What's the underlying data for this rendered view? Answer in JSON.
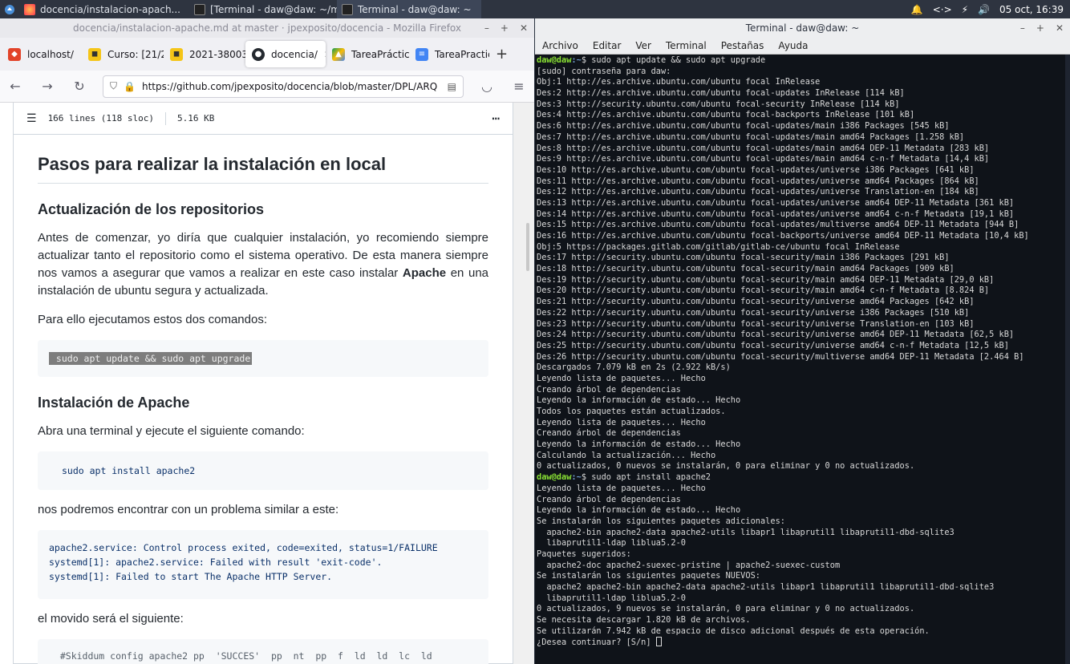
{
  "taskbar": {
    "tasks": [
      {
        "label": "docencia/instalacion-apach..."
      },
      {
        "label": "[Terminal - daw@daw: ~/med..."
      },
      {
        "label": "Terminal - daw@daw: ~"
      }
    ],
    "clock": "05 oct, 16:39"
  },
  "firefox": {
    "title": "docencia/instalacion-apache.md at master · jpexposito/docencia - Mozilla Firefox",
    "tabs": [
      {
        "label": "localhost/"
      },
      {
        "label": "Curso: [21/2"
      },
      {
        "label": "2021-38003"
      },
      {
        "label": "docencia/"
      },
      {
        "label": "TareaPráctic"
      },
      {
        "label": "TareaPractic"
      }
    ],
    "url": "https://github.com/jpexposito/docencia/blob/master/DPL/ARQ",
    "file_info": {
      "lines": "166 lines (118 sloc)",
      "size": "5.16 KB"
    },
    "doc": {
      "h1": "Pasos para realizar la instalación en local",
      "h2_repos": "Actualización de los repositorios",
      "p1_before": "Antes de comenzar, yo diría que cualquier instalación, yo recomiendo siempre actualizar tanto el repositorio como el sistema operativo. De esta manera siempre nos vamos a asegurar que vamos a realizar en este caso instalar ",
      "p1_bold": "Apache",
      "p1_after": " en una instalación de ubuntu segura y actualizada.",
      "p2": "Para ello ejecutamos estos dos comandos:",
      "code1": " sudo apt update && sudo apt upgrade",
      "h2_apache": "Instalación de Apache",
      "p3": "Abra una terminal y ejecute el siguiente comando:",
      "code2": "sudo apt install apache2",
      "p4": "nos podremos encontrar con un problema similar a este:",
      "code3": "apache2.service: Control process exited, code=exited, status=1/FAILURE\nsystemd[1]: apache2.service: Failed with result 'exit-code'.\nsystemd[1]: Failed to start The Apache HTTP Server.",
      "p5": "el movido será el siguiente:",
      "code4": "  #Skiddum config apache2 pp  'SUCCES'  pp  nt  pp  f  ld  ld  lc  ld"
    }
  },
  "terminal": {
    "title": "Terminal - daw@daw: ~",
    "menu": [
      "Archivo",
      "Editar",
      "Ver",
      "Terminal",
      "Pestañas",
      "Ayuda"
    ],
    "prompt_user": "daw@daw",
    "prompt_path": ":~",
    "cmd1": "$ sudo apt update && sudo apt upgrade",
    "output1": [
      "[sudo] contraseña para daw:",
      "Obj:1 http://es.archive.ubuntu.com/ubuntu focal InRelease",
      "Des:2 http://es.archive.ubuntu.com/ubuntu focal-updates InRelease [114 kB]",
      "Des:3 http://security.ubuntu.com/ubuntu focal-security InRelease [114 kB]",
      "Des:4 http://es.archive.ubuntu.com/ubuntu focal-backports InRelease [101 kB]",
      "Des:6 http://es.archive.ubuntu.com/ubuntu focal-updates/main i386 Packages [545 kB]",
      "Des:7 http://es.archive.ubuntu.com/ubuntu focal-updates/main amd64 Packages [1.258 kB]",
      "Des:8 http://es.archive.ubuntu.com/ubuntu focal-updates/main amd64 DEP-11 Metadata [283 kB]",
      "Des:9 http://es.archive.ubuntu.com/ubuntu focal-updates/main amd64 c-n-f Metadata [14,4 kB]",
      "Des:10 http://es.archive.ubuntu.com/ubuntu focal-updates/universe i386 Packages [641 kB]",
      "Des:11 http://es.archive.ubuntu.com/ubuntu focal-updates/universe amd64 Packages [864 kB]",
      "Des:12 http://es.archive.ubuntu.com/ubuntu focal-updates/universe Translation-en [184 kB]",
      "Des:13 http://es.archive.ubuntu.com/ubuntu focal-updates/universe amd64 DEP-11 Metadata [361 kB]",
      "Des:14 http://es.archive.ubuntu.com/ubuntu focal-updates/universe amd64 c-n-f Metadata [19,1 kB]",
      "Des:15 http://es.archive.ubuntu.com/ubuntu focal-updates/multiverse amd64 DEP-11 Metadata [944 B]",
      "Des:16 http://es.archive.ubuntu.com/ubuntu focal-backports/universe amd64 DEP-11 Metadata [10,4 kB]",
      "Obj:5 https://packages.gitlab.com/gitlab/gitlab-ce/ubuntu focal InRelease",
      "Des:17 http://security.ubuntu.com/ubuntu focal-security/main i386 Packages [291 kB]",
      "Des:18 http://security.ubuntu.com/ubuntu focal-security/main amd64 Packages [909 kB]",
      "Des:19 http://security.ubuntu.com/ubuntu focal-security/main amd64 DEP-11 Metadata [29,0 kB]",
      "Des:20 http://security.ubuntu.com/ubuntu focal-security/main amd64 c-n-f Metadata [8.824 B]",
      "Des:21 http://security.ubuntu.com/ubuntu focal-security/universe amd64 Packages [642 kB]",
      "Des:22 http://security.ubuntu.com/ubuntu focal-security/universe i386 Packages [510 kB]",
      "Des:23 http://security.ubuntu.com/ubuntu focal-security/universe Translation-en [103 kB]",
      "Des:24 http://security.ubuntu.com/ubuntu focal-security/universe amd64 DEP-11 Metadata [62,5 kB]",
      "Des:25 http://security.ubuntu.com/ubuntu focal-security/universe amd64 c-n-f Metadata [12,5 kB]",
      "Des:26 http://security.ubuntu.com/ubuntu focal-security/multiverse amd64 DEP-11 Metadata [2.464 B]",
      "Descargados 7.079 kB en 2s (2.922 kB/s)",
      "Leyendo lista de paquetes... Hecho",
      "Creando árbol de dependencias",
      "Leyendo la información de estado... Hecho",
      "Todos los paquetes están actualizados.",
      "Leyendo lista de paquetes... Hecho",
      "Creando árbol de dependencias",
      "Leyendo la información de estado... Hecho",
      "Calculando la actualización... Hecho",
      "0 actualizados, 0 nuevos se instalarán, 0 para eliminar y 0 no actualizados."
    ],
    "cmd2": "$ sudo apt install apache2",
    "output2": [
      "Leyendo lista de paquetes... Hecho",
      "Creando árbol de dependencias",
      "Leyendo la información de estado... Hecho",
      "Se instalarán los siguientes paquetes adicionales:",
      "  apache2-bin apache2-data apache2-utils libapr1 libaprutil1 libaprutil1-dbd-sqlite3",
      "  libaprutil1-ldap liblua5.2-0",
      "Paquetes sugeridos:",
      "  apache2-doc apache2-suexec-pristine | apache2-suexec-custom",
      "Se instalarán los siguientes paquetes NUEVOS:",
      "  apache2 apache2-bin apache2-data apache2-utils libapr1 libaprutil1 libaprutil1-dbd-sqlite3",
      "  libaprutil1-ldap liblua5.2-0",
      "0 actualizados, 9 nuevos se instalarán, 0 para eliminar y 0 no actualizados.",
      "Se necesita descargar 1.820 kB de archivos.",
      "Se utilizarán 7.942 kB de espacio de disco adicional después de esta operación."
    ],
    "final_prompt": "¿Desea continuar? [S/n] "
  }
}
